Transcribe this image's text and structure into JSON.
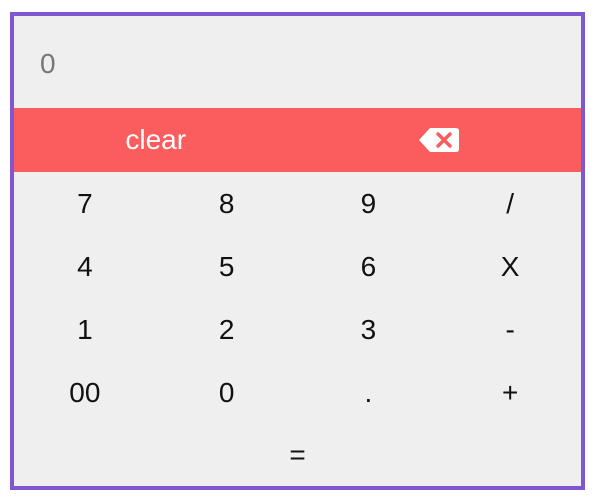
{
  "display": {
    "value": "0"
  },
  "actions": {
    "clear_label": "clear",
    "backspace_icon": "backspace-icon"
  },
  "keys": [
    {
      "label": "7",
      "name": "key-7"
    },
    {
      "label": "8",
      "name": "key-8"
    },
    {
      "label": "9",
      "name": "key-9"
    },
    {
      "label": "/",
      "name": "key-divide"
    },
    {
      "label": "4",
      "name": "key-4"
    },
    {
      "label": "5",
      "name": "key-5"
    },
    {
      "label": "6",
      "name": "key-6"
    },
    {
      "label": "X",
      "name": "key-multiply"
    },
    {
      "label": "1",
      "name": "key-1"
    },
    {
      "label": "2",
      "name": "key-2"
    },
    {
      "label": "3",
      "name": "key-3"
    },
    {
      "label": "-",
      "name": "key-subtract"
    },
    {
      "label": "00",
      "name": "key-00"
    },
    {
      "label": "0",
      "name": "key-0"
    },
    {
      "label": ".",
      "name": "key-decimal"
    },
    {
      "label": "+",
      "name": "key-add"
    }
  ],
  "equals": {
    "label": "="
  },
  "colors": {
    "frame": "#7f57d1",
    "background": "#efefef",
    "action_bar": "#fb5c5e",
    "display_text": "#777777"
  }
}
